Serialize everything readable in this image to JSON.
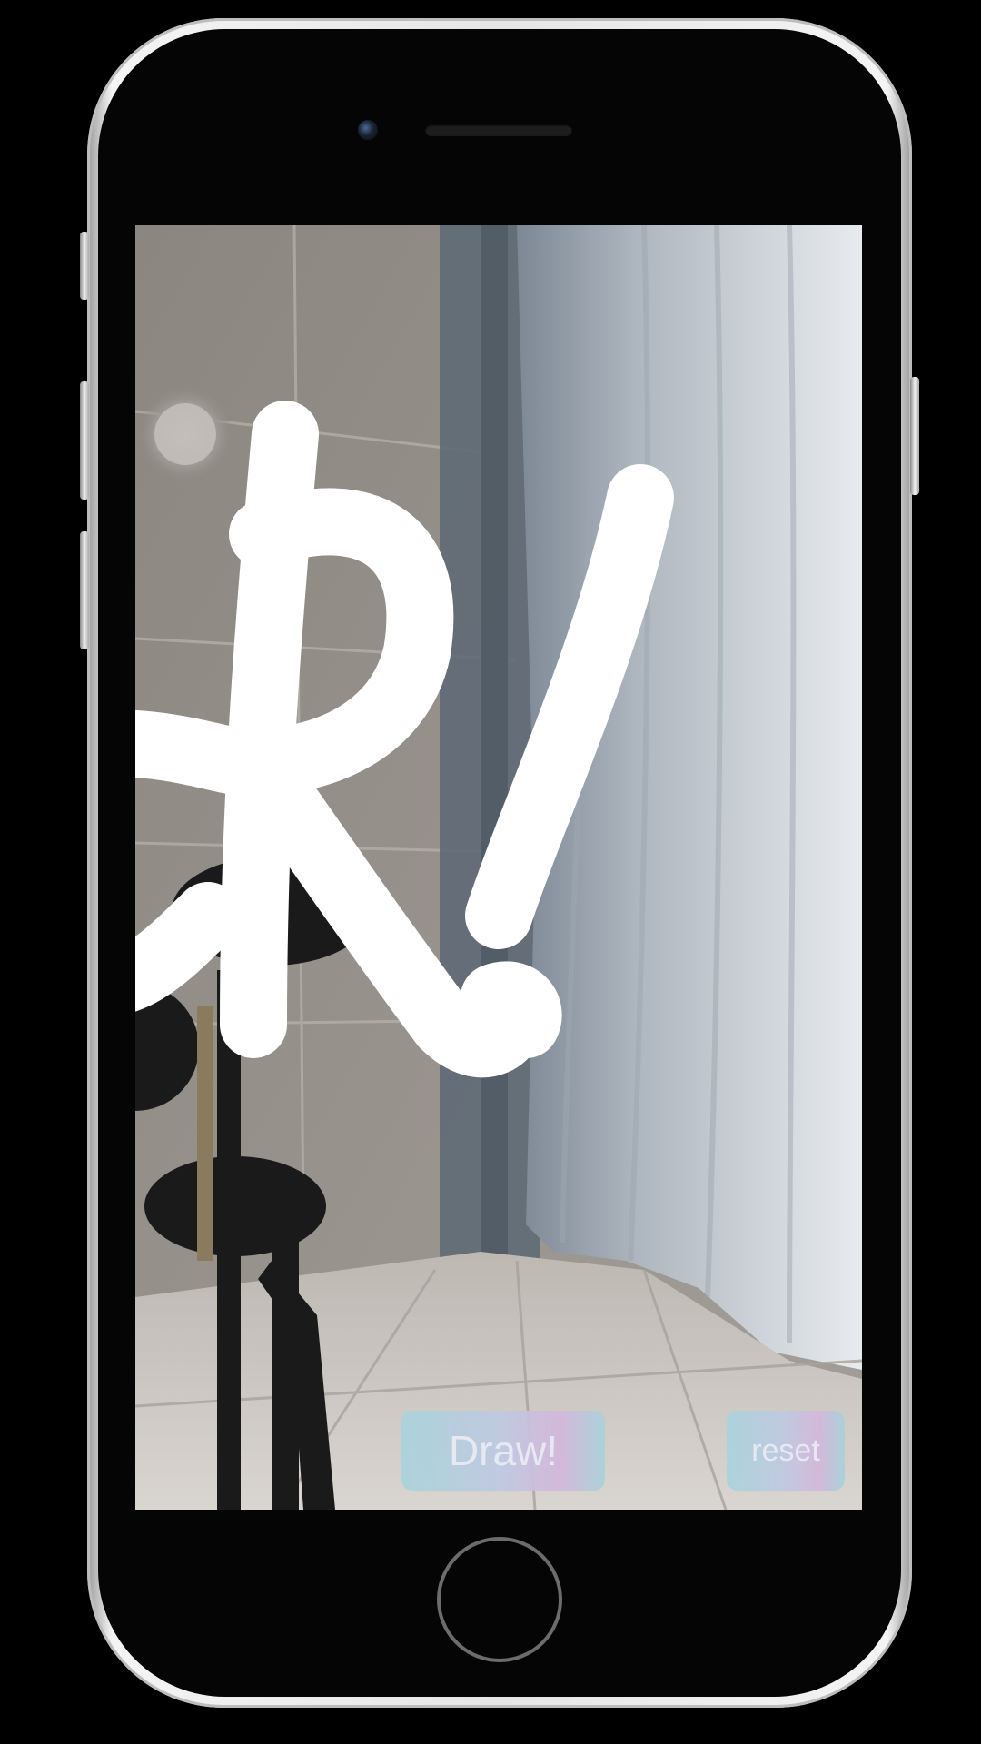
{
  "app": {
    "draw_label": "Draw!",
    "reset_label": "reset"
  },
  "icons": {
    "focus": "focus-circle-icon",
    "camera": "front-camera-icon"
  },
  "colors": {
    "stroke": "#ffffff",
    "button_gradient_start": "#a9d4dc",
    "button_gradient_end": "#d4b7dc",
    "button_text": "#e9ecf6"
  }
}
